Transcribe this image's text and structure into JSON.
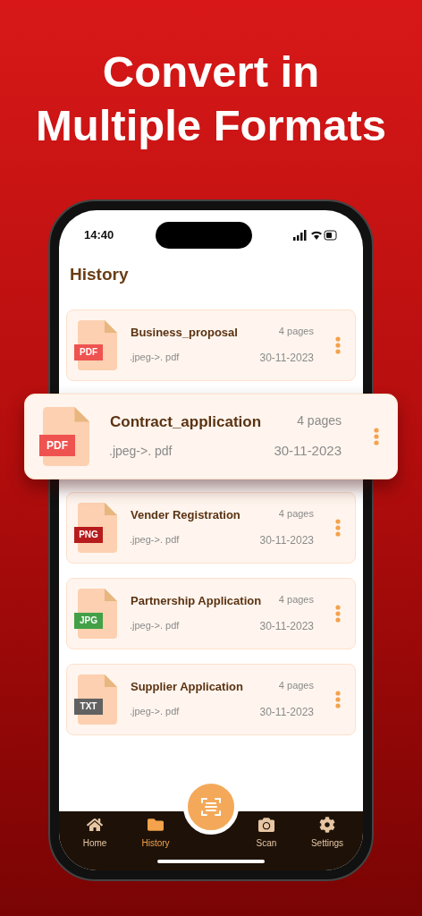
{
  "headline": [
    "Convert in",
    "Multiple Formats"
  ],
  "status_bar": {
    "time": "14:40"
  },
  "screen_title": "History",
  "documents": [
    {
      "name": "Business_proposal",
      "format": "PDF",
      "color": "#ef5350",
      "conversion": ".jpeg->. pdf",
      "pages": "4 pages",
      "date": "30-11-2023",
      "highlighted": false
    },
    {
      "name": "Contract_application",
      "format": "PDF",
      "color": "#ef5350",
      "conversion": ".jpeg->. pdf",
      "pages": "4 pages",
      "date": "30-11-2023",
      "highlighted": true
    },
    {
      "name": "Vender Registration",
      "format": "PNG",
      "color": "#b71c1c",
      "conversion": ".jpeg->. pdf",
      "pages": "4 pages",
      "date": "30-11-2023",
      "highlighted": false
    },
    {
      "name": "Partnership Application",
      "format": "JPG",
      "color": "#43a047",
      "conversion": ".jpeg->. pdf",
      "pages": "4 pages",
      "date": "30-11-2023",
      "highlighted": false
    },
    {
      "name": "Supplier Application",
      "format": "TXT",
      "color": "#616161",
      "conversion": ".jpeg->. pdf",
      "pages": "4 pages",
      "date": "30-11-2023",
      "highlighted": false
    }
  ],
  "nav": [
    {
      "label": "Home",
      "kind": "home",
      "selected": false
    },
    {
      "label": "History",
      "kind": "history",
      "selected": true
    },
    {
      "label": "Scan",
      "kind": "scan",
      "selected": false
    },
    {
      "label": "Settings",
      "kind": "settings",
      "selected": false
    }
  ]
}
